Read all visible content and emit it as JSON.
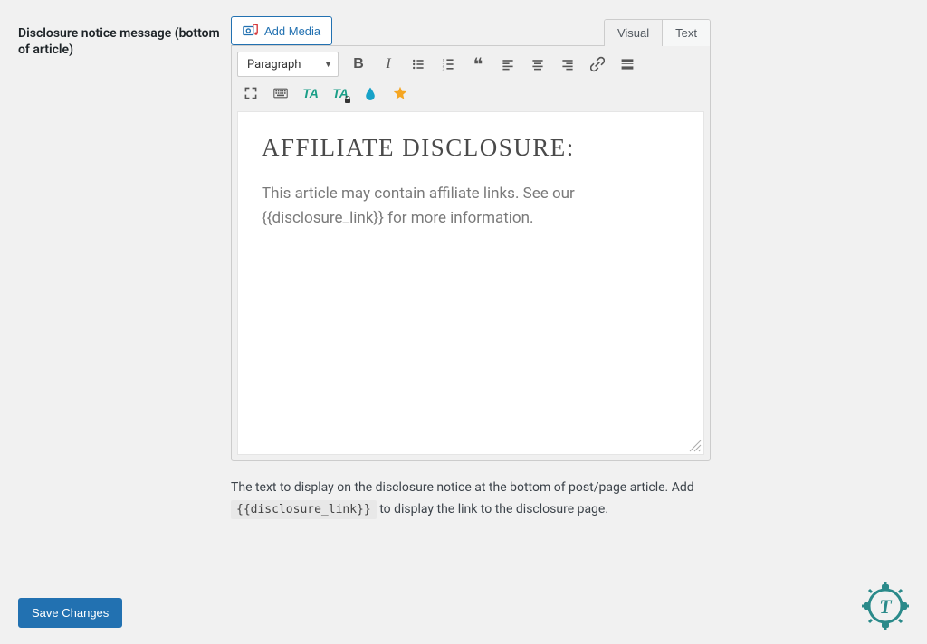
{
  "field": {
    "label": "Disclosure notice message (bottom of article)"
  },
  "addMedia": {
    "label": "Add Media"
  },
  "tabs": {
    "visual": "Visual",
    "text": "Text"
  },
  "formatSelect": {
    "value": "Paragraph"
  },
  "toolbarRow1": {
    "bold": "B",
    "italic": "I",
    "ul": "ul",
    "ol": "ol",
    "quote": "❝",
    "alignLeft": "al",
    "alignCenter": "ac",
    "alignRight": "ar",
    "link": "link",
    "more": "more"
  },
  "toolbarRow2": {
    "fullscreen": "fs",
    "table": "tbl",
    "ta1": "TA",
    "ta2": "TA",
    "drop": "drop",
    "star": "star"
  },
  "content": {
    "heading": "AFFILIATE DISCLOSURE:",
    "body": "This article may contain affiliate links. See our {{disclosure_link}} for more information."
  },
  "help": {
    "before": "The text to display on the disclosure notice at the bottom of post/page article. Add ",
    "code": "{{disclosure_link}}",
    "after": " to display the link to the disclosure page."
  },
  "save": {
    "label": "Save Changes"
  }
}
